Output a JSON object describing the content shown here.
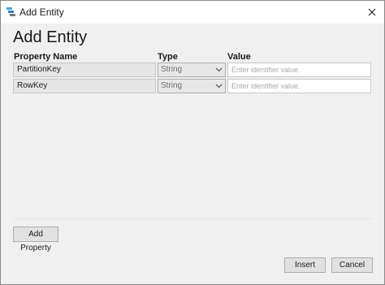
{
  "window": {
    "title": "Add Entity",
    "app_icon": "storage-explorer-icon",
    "close_icon": "close-icon"
  },
  "dialog": {
    "heading": "Add Entity",
    "columns": {
      "name": "Property Name",
      "type": "Type",
      "value": "Value"
    },
    "rows": [
      {
        "name": "PartitionKey",
        "type": "String",
        "value": "",
        "placeholder": "Enter identifier value."
      },
      {
        "name": "RowKey",
        "type": "String",
        "value": "",
        "placeholder": "Enter identifier value."
      }
    ],
    "add_property_label": "Add Property",
    "insert_label": "Insert",
    "cancel_label": "Cancel"
  },
  "colors": {
    "dialog_bg": "#f0f0f0",
    "name_cell_bg": "#e6e6e6",
    "button_bg": "#e1e1e1",
    "placeholder": "#a9a9a9"
  }
}
